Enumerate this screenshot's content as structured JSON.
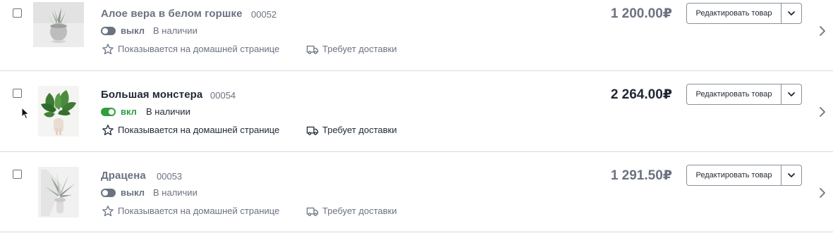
{
  "colors": {
    "muted_text": "#6b7280",
    "dark_text": "#1f2733",
    "toggle_on": "#2e9e3f",
    "divider": "#d6d9dd",
    "button_border": "#8a9099"
  },
  "common": {
    "featured_label": "Показывается на домашней странице",
    "shipping_label": "Требует доставки",
    "featured_icon": "star-icon",
    "shipping_icon": "truck-icon",
    "edit_label": "Редактировать товар",
    "edit_menu_icon": "chevron-down-icon",
    "row_open_icon": "chevron-right-icon"
  },
  "products": [
    {
      "title": "Алое вера в белом горшке",
      "sku": "00052",
      "enabled": false,
      "toggle_label": "выкл",
      "stock": "В наличии",
      "price": "1 200.00₽",
      "image": "aloe-pot-image"
    },
    {
      "title": "Большая монстера",
      "sku": "00054",
      "enabled": true,
      "toggle_label": "вкл",
      "stock": "В наличии",
      "price": "2 264.00₽",
      "image": "monstera-image"
    },
    {
      "title": "Драцена",
      "sku": "00053",
      "enabled": false,
      "toggle_label": "выкл",
      "stock": "В наличии",
      "price": "1 291.50₽",
      "image": "dracaena-image"
    }
  ]
}
